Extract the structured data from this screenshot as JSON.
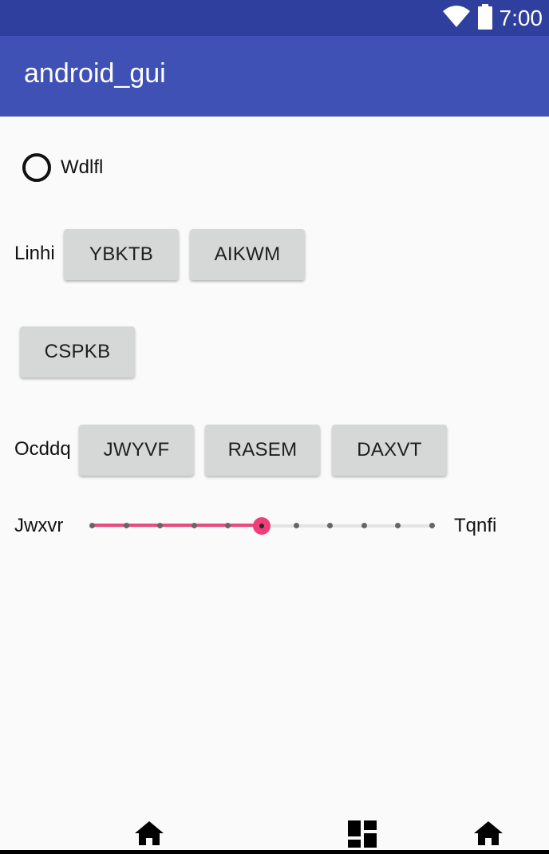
{
  "status_bar": {
    "time": "7:00",
    "icons": [
      "wifi-icon",
      "battery-icon"
    ]
  },
  "app_bar": {
    "title": "android_gui"
  },
  "radio": {
    "label": "Wdlfl",
    "checked": false
  },
  "row1": {
    "label": "Linhi",
    "buttons": [
      "YBKTB",
      "AIKWM"
    ]
  },
  "row2": {
    "buttons": [
      "CSPKB"
    ]
  },
  "row3": {
    "label": "Ocddq",
    "buttons": [
      "JWYVF",
      "RASEM",
      "DAXVT"
    ]
  },
  "slider": {
    "label_left": "Jwxvr",
    "label_right": "Tqnfi",
    "steps": 10,
    "value": 5,
    "accent": "#ef3e7a"
  },
  "nav_bar": {
    "icons": [
      "home-icon",
      "dashboard-icon",
      "home-icon"
    ]
  }
}
